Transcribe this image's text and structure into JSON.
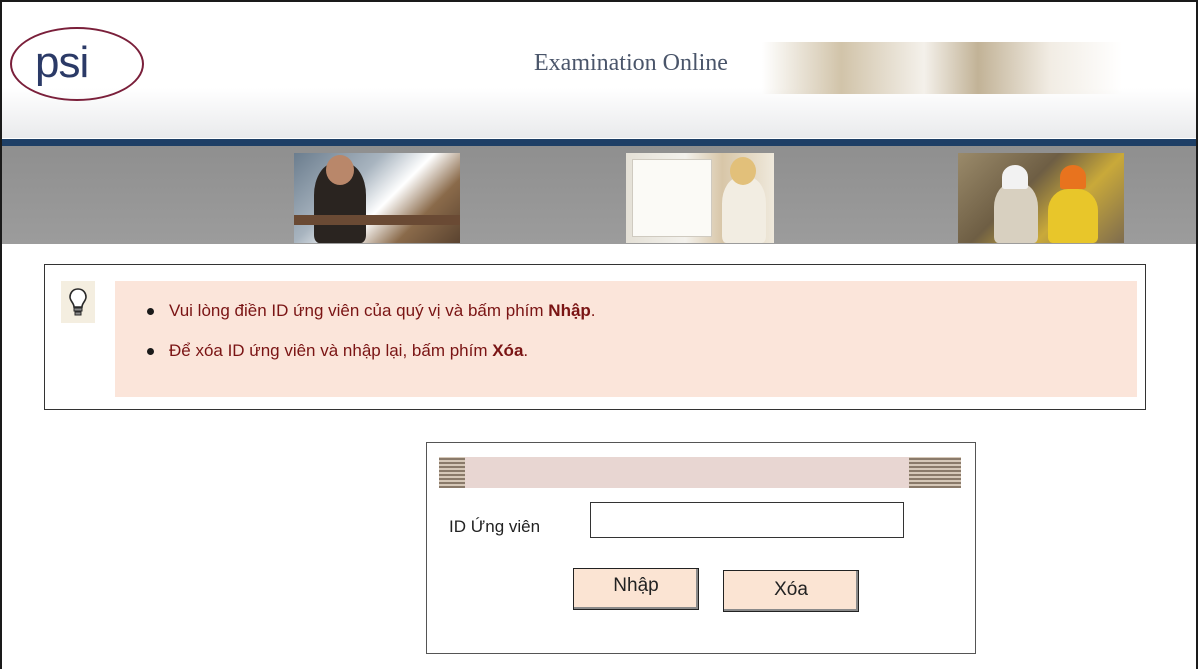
{
  "header": {
    "logo_text": "psi",
    "title": "Examination Online"
  },
  "instructions": {
    "items": [
      {
        "text": "Vui lòng điền ID ứng viên của quý vị và bấm phím ",
        "bold": "Nhập",
        "end": "."
      },
      {
        "text": "Để xóa ID ứng viên và nhập lại, bấm phím ",
        "bold": "Xóa",
        "end": "."
      }
    ],
    "icon": "lightbulb-icon"
  },
  "login": {
    "id_label": "ID Ứng viên",
    "id_value": "",
    "enter_label": "Nhập",
    "clear_label": "Xóa"
  },
  "colors": {
    "brand_navy": "#1e3f66",
    "logo_ring": "#7a1f3a",
    "instruction_text": "#7a1414",
    "instruction_bg": "#fbe5da",
    "button_bg": "#fbe4d3"
  }
}
